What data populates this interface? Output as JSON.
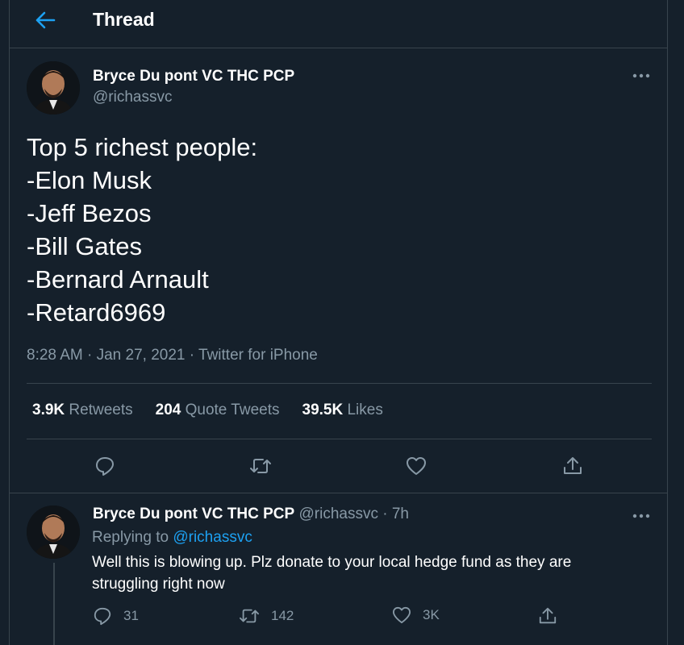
{
  "header": {
    "title": "Thread",
    "back_icon": "arrow-left-icon"
  },
  "colors": {
    "background": "#15202b",
    "border": "#38444d",
    "secondary_text": "#8899a6",
    "accent": "#1da1f2"
  },
  "tweet": {
    "author_name": "Bryce Du pont VC THC PCP",
    "author_handle": "@richassvc",
    "lines": [
      "Top 5 richest people:",
      "-Elon Musk",
      "-Jeff Bezos",
      "-Bill Gates",
      "-Bernard Arnault",
      "-Retard6969"
    ],
    "time": "8:28 AM",
    "date": "Jan 27, 2021",
    "source": "Twitter for iPhone",
    "stats": {
      "retweets_count": "3.9K",
      "retweets_label": "Retweets",
      "quotes_count": "204",
      "quotes_label": "Quote Tweets",
      "likes_count": "39.5K",
      "likes_label": "Likes"
    }
  },
  "reply": {
    "author_name": "Bryce Du pont VC THC PCP",
    "author_handle": "@richassvc",
    "age": "7h",
    "replying_prefix": "Replying to",
    "replying_to": "@richassvc",
    "text": "Well this is blowing up. Plz donate to your local hedge fund as they are struggling right now",
    "reply_count": "31",
    "retweet_count": "142",
    "like_count": "3K"
  }
}
